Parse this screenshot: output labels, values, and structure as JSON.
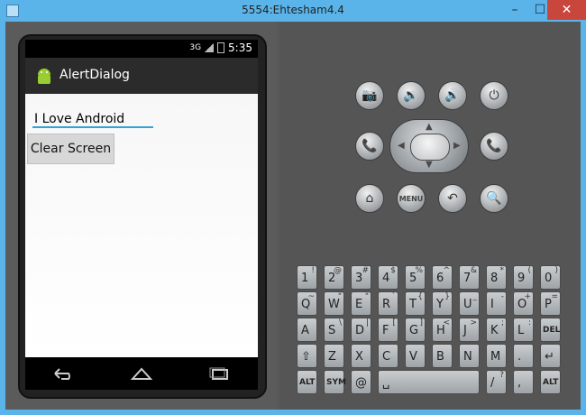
{
  "window": {
    "title": "5554:Ehtesham4.4",
    "minimize": "–",
    "maximize": "☐",
    "close": "✕"
  },
  "phone": {
    "status": {
      "network": "3G",
      "time": "5:35"
    },
    "app_title": "AlertDialog",
    "edit_value": "I Love Android",
    "button_label": "Clear Screen",
    "nav": {
      "back_icon": "back-icon",
      "home_icon": "home-icon",
      "recent_icon": "recent-apps-icon"
    }
  },
  "controls": {
    "row1": [
      {
        "name": "camera-button",
        "icon": "📷"
      },
      {
        "name": "volume-down-button",
        "icon": "🔉"
      },
      {
        "name": "volume-up-button",
        "icon": "🔊"
      },
      {
        "name": "power-button",
        "icon": "⏻"
      }
    ],
    "call_icon": "📞",
    "end_icon": "📞",
    "row3": [
      {
        "name": "home-button",
        "icon": "⌂"
      },
      {
        "name": "menu-button",
        "icon": "MENU"
      },
      {
        "name": "back-button",
        "icon": "↶"
      },
      {
        "name": "search-button",
        "icon": "🔍"
      }
    ]
  },
  "keyboard": {
    "row1": [
      {
        "main": "1",
        "sub": "!"
      },
      {
        "main": "2",
        "sub": "@"
      },
      {
        "main": "3",
        "sub": "#"
      },
      {
        "main": "4",
        "sub": "$"
      },
      {
        "main": "5",
        "sub": "%"
      },
      {
        "main": "6",
        "sub": "^"
      },
      {
        "main": "7",
        "sub": "&"
      },
      {
        "main": "8",
        "sub": "*"
      },
      {
        "main": "9",
        "sub": "("
      },
      {
        "main": "0",
        "sub": ")"
      }
    ],
    "row2": [
      {
        "main": "Q",
        "sub": "~"
      },
      {
        "main": "W",
        "sub": "\""
      },
      {
        "main": "E",
        "sub": "\""
      },
      {
        "main": "R",
        "sub": "`"
      },
      {
        "main": "T",
        "sub": "{"
      },
      {
        "main": "Y",
        "sub": "}"
      },
      {
        "main": "U",
        "sub": "_"
      },
      {
        "main": "I",
        "sub": "-"
      },
      {
        "main": "O",
        "sub": "+"
      },
      {
        "main": "P",
        "sub": "="
      }
    ],
    "row3": [
      {
        "main": "A",
        "sub": ""
      },
      {
        "main": "S",
        "sub": "\\"
      },
      {
        "main": "D",
        "sub": "|"
      },
      {
        "main": "F",
        "sub": "["
      },
      {
        "main": "G",
        "sub": "]"
      },
      {
        "main": "H",
        "sub": "<"
      },
      {
        "main": "J",
        "sub": ">"
      },
      {
        "main": "K",
        "sub": ";"
      },
      {
        "main": "L",
        "sub": ":"
      },
      {
        "main": "DEL",
        "sub": ""
      }
    ],
    "row4": [
      {
        "main": "⇧",
        "sub": ""
      },
      {
        "main": "Z",
        "sub": ""
      },
      {
        "main": "X",
        "sub": ""
      },
      {
        "main": "C",
        "sub": ""
      },
      {
        "main": "V",
        "sub": ""
      },
      {
        "main": "B",
        "sub": ""
      },
      {
        "main": "N",
        "sub": ""
      },
      {
        "main": "M",
        "sub": ""
      },
      {
        "main": ".",
        "sub": ""
      },
      {
        "main": "↵",
        "sub": ""
      }
    ],
    "row5": [
      {
        "main": "ALT",
        "sub": ""
      },
      {
        "main": "SYM",
        "sub": ""
      },
      {
        "main": "@",
        "sub": ""
      },
      {
        "main": "␣",
        "sub": ""
      },
      {
        "main": "/",
        "sub": "?"
      },
      {
        "main": ",",
        "sub": ""
      },
      {
        "main": "ALT",
        "sub": ""
      }
    ]
  }
}
